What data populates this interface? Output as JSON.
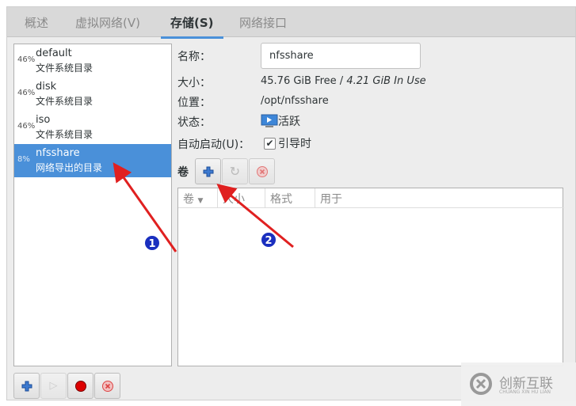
{
  "tabs": [
    {
      "label": "概述"
    },
    {
      "label": "虚拟网络(V)"
    },
    {
      "label": "存储(S)",
      "active": true
    },
    {
      "label": "网络接口"
    }
  ],
  "pools": [
    {
      "percent": "46%",
      "name": "default",
      "type": "文件系统目录"
    },
    {
      "percent": "46%",
      "name": "disk",
      "type": "文件系统目录"
    },
    {
      "percent": "46%",
      "name": "iso",
      "type": "文件系统目录"
    },
    {
      "percent": "8%",
      "name": "nfsshare",
      "type": "网络导出的目录",
      "selected": true
    }
  ],
  "details": {
    "name_label": "名称：",
    "name_value": "nfsshare",
    "size_label": "大小：",
    "size_free": "45.76 GiB Free",
    "size_sep": " / ",
    "size_used": "4.21 GiB In Use",
    "location_label": "位置：",
    "location_value": "/opt/nfsshare",
    "state_label": "状态：",
    "state_value": "活跃",
    "autostart_label": "自动启动(U)：",
    "autostart_value": "引导时",
    "autostart_checked": true
  },
  "volumes": {
    "label": "卷",
    "columns": [
      "卷",
      "大小",
      "格式",
      "用于"
    ],
    "rows": []
  },
  "annotations": [
    "1",
    "2"
  ],
  "watermark": {
    "text": "创新互联",
    "sub": "CHUANG XIN HU LIAN"
  },
  "colors": {
    "accent": "#4a90d9",
    "arrow": "#e02020",
    "badge": "#1a2fbf"
  }
}
